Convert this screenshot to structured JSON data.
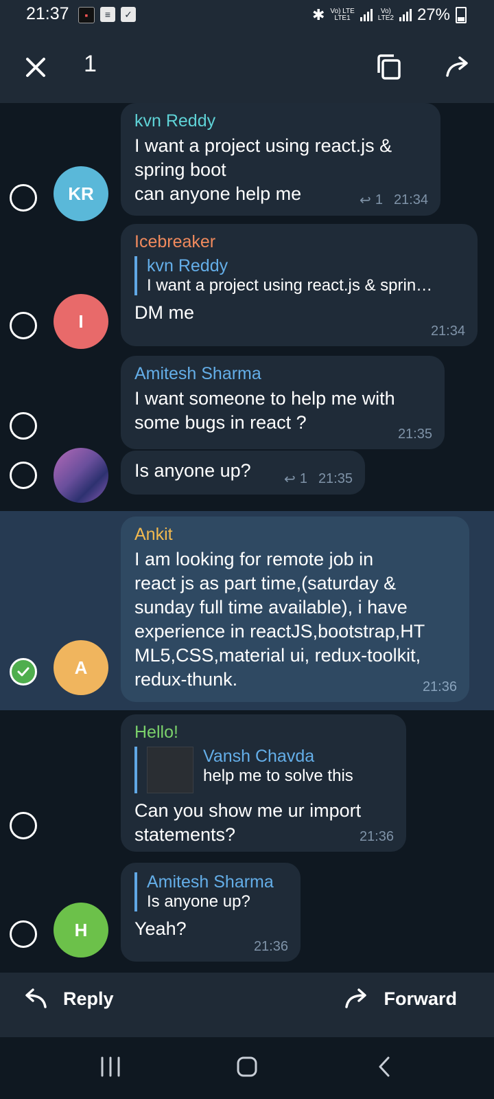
{
  "status_bar": {
    "time": "21:37",
    "battery": "27%",
    "sim1": "Vo) LTE\nLTE1",
    "sim2": "Vo)\nLTE2"
  },
  "toolbar": {
    "selected_count": "1"
  },
  "messages": [
    {
      "sender": "kvn Reddy",
      "sender_color": "#5fd3d7",
      "avatar_initials": "KR",
      "avatar_color": "#5ab8d9",
      "text": "I want a project using react.js &\nspring boot\ncan anyone help me",
      "reply_count": "1",
      "time": "21:34"
    },
    {
      "sender": "Icebreaker",
      "sender_color": "#f08a5d",
      "avatar_initials": "I",
      "avatar_color": "#e86a6a",
      "quote_name": "kvn Reddy",
      "quote_text": "I want a project using react.js & sprin…",
      "text": "DM me",
      "time": "21:34"
    },
    {
      "sender": "Amitesh Sharma",
      "sender_color": "#64aee8",
      "text": "I want someone to help me with\nsome bugs in react ?",
      "time": "21:35"
    },
    {
      "text": "Is anyone up?",
      "reply_count": "1",
      "time": "21:35"
    },
    {
      "sender": "Ankit",
      "sender_color": "#f2b94f",
      "avatar_initials": "A",
      "avatar_color": "#f0b55e",
      "text": "I am looking for remote job in\nreact js as part time,(saturday &\nsunday full time available), i have\nexperience in reactJS,bootstrap,HT\nML5,CSS,material ui, redux-toolkit,\nredux-thunk.",
      "time": "21:36",
      "selected": true
    },
    {
      "sender": "Hello!",
      "sender_color": "#7bd16b",
      "quote_name": "Vansh Chavda",
      "quote_text": "help me to solve this",
      "text": "Can you show me ur import\nstatements?",
      "time": "21:36"
    },
    {
      "avatar_initials": "H",
      "avatar_color": "#6cc14a",
      "quote_name": "Amitesh Sharma",
      "quote_text": "Is anyone up?",
      "text": "Yeah?",
      "time": "21:36"
    }
  ],
  "actions": {
    "reply_label": "Reply",
    "forward_label": "Forward"
  }
}
